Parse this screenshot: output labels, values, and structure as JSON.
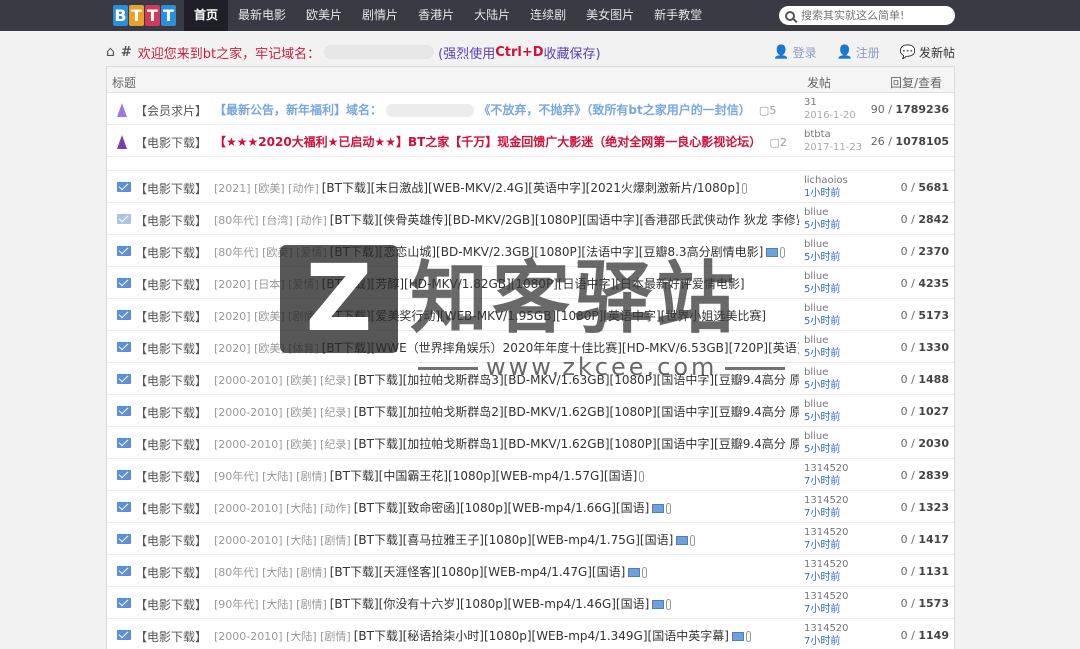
{
  "logo": [
    "B",
    "T",
    "T",
    "T"
  ],
  "nav": [
    "首页",
    "最新电影",
    "欧美片",
    "剧情片",
    "香港片",
    "大陆片",
    "连续剧",
    "美女图片",
    "新手教堂"
  ],
  "search": {
    "placeholder": "搜索其实就这么简单!"
  },
  "welcome": {
    "part1": "欢迎您来到bt之家，牢记域名：",
    "part2": "(强烈使用",
    "ctrl": "Ctrl+D",
    "part3": "收藏保存)"
  },
  "user_links": {
    "login": "登录",
    "register": "注册",
    "post": "发新帖"
  },
  "table_header": {
    "title": "标题",
    "author": "发帖",
    "replies": "回复/查看"
  },
  "pinned": [
    {
      "cat": "【会员求片】",
      "t1": "【最新公告，新年福利】域名：",
      "t2": "《不放弃，不抛弃》（致所有bt之家用户的一封信）",
      "count": "5",
      "author": "31",
      "time": "2016-1-20",
      "replies": "90",
      "views": "1789236"
    },
    {
      "cat": "【电影下载】",
      "t1": "【★★★2020大福利★已启动★★】BT之家【千万】现金回馈广大影迷（绝对全网第一良心影视论坛）",
      "count": "2",
      "author": "btbta",
      "time": "2017-11-23",
      "replies": "26",
      "views": "1078105"
    }
  ],
  "rows": [
    {
      "cat": "【电影下载】",
      "tags": "[2021] [欧美] [动作]",
      "title": "[BT下载][末日激战][WEB-MKV/2.4G][英语中字][2021火爆刺激新片/1080p]",
      "author": "lichaoios",
      "time": "1小时前",
      "replies": "0",
      "views": "5681"
    },
    {
      "cat": "【电影下载】",
      "tags": "[80年代] [台湾] [动作]",
      "title": "[BT下载][侠骨英雄传][BD-MKV/2GB][1080P][国语中字][香港邵氏武侠动作 狄龙 李修贤",
      "author": "bliue",
      "time": "5小时前",
      "replies": "0",
      "views": "2842"
    },
    {
      "cat": "【电影下载】",
      "tags": "[80年代] [欧美] [爱情]",
      "title": "[BT下载][恋恋山城][BD-MKV/2.3GB][1080P][法语中字][豆瓣8.3高分剧情电影]",
      "author": "bliue",
      "time": "5小时前",
      "replies": "0",
      "views": "2370"
    },
    {
      "cat": "【电影下载】",
      "tags": "[2020] [日本] [爱情]",
      "title": "[BT下载][芳醇][HD-MKV/1.82GB][1080P][日语中字][日本最新好评爱情电影]",
      "author": "bliue",
      "time": "5小时前",
      "replies": "0",
      "views": "4235"
    },
    {
      "cat": "【电影下载】",
      "tags": "[2020] [欧美] [剧情]",
      "title": "[BT下载][爱美奖行动][WEB-MKV/1.95GB][1080P][英语中字][世界小姐选美比赛]",
      "author": "bliue",
      "time": "5小时前",
      "replies": "0",
      "views": "5173"
    },
    {
      "cat": "【电影下载】",
      "tags": "[2020] [欧美] [体育]",
      "title": "[BT下载][WWE（世界摔角娱乐）2020年年度十佳比赛][HD-MKV/6.53GB][720P][英语]",
      "author": "bliue",
      "time": "5小时前",
      "replies": "0",
      "views": "1330"
    },
    {
      "cat": "【电影下载】",
      "tags": "[2000-2010] [欧美] [纪录]",
      "title": "[BT下载][加拉帕戈斯群岛3][BD-MKV/1.63GB][1080P][国语中字][豆瓣9.4高分 原生",
      "author": "bliue",
      "time": "5小时前",
      "replies": "0",
      "views": "1488"
    },
    {
      "cat": "【电影下载】",
      "tags": "[2000-2010] [欧美] [纪录]",
      "title": "[BT下载][加拉帕戈斯群岛2][BD-MKV/1.62GB][1080P][国语中字][豆瓣9.4高分 原生",
      "author": "bliue",
      "time": "5小时前",
      "replies": "0",
      "views": "1027"
    },
    {
      "cat": "【电影下载】",
      "tags": "[2000-2010] [欧美] [纪录]",
      "title": "[BT下载][加拉帕戈斯群岛1][BD-MKV/1.62GB][1080P][国语中字][豆瓣9.4高分 原生",
      "author": "bliue",
      "time": "5小时前",
      "replies": "0",
      "views": "2030"
    },
    {
      "cat": "【电影下载】",
      "tags": "[90年代] [大陆] [剧情]",
      "title": "[BT下载][中国霸王花][1080p][WEB-mp4/1.57G][国语]",
      "author": "1314520",
      "time": "7小时前",
      "replies": "0",
      "views": "2839"
    },
    {
      "cat": "【电影下载】",
      "tags": "[2000-2010] [大陆] [动作]",
      "title": "[BT下载][致命密函][1080p][WEB-mp4/1.66G][国语]",
      "author": "1314520",
      "time": "7小时前",
      "replies": "0",
      "views": "1323"
    },
    {
      "cat": "【电影下载】",
      "tags": "[2000-2010] [大陆] [剧情]",
      "title": "[BT下载][喜马拉雅王子][1080p][WEB-mp4/1.75G][国语]",
      "author": "1314520",
      "time": "7小时前",
      "replies": "0",
      "views": "1417"
    },
    {
      "cat": "【电影下载】",
      "tags": "[80年代] [大陆] [剧情]",
      "title": "[BT下载][天涯怪客][1080p][WEB-mp4/1.47G][国语]",
      "author": "1314520",
      "time": "7小时前",
      "replies": "0",
      "views": "1131"
    },
    {
      "cat": "【电影下载】",
      "tags": "[90年代] [大陆] [剧情]",
      "title": "[BT下载][你没有十六岁][1080p][WEB-mp4/1.46G][国语]",
      "author": "1314520",
      "time": "7小时前",
      "replies": "0",
      "views": "1573"
    },
    {
      "cat": "【电影下载】",
      "tags": "[2000-2010] [大陆] [剧情]",
      "title": "[BT下载][秘语拾柒小时][1080p][WEB-mp4/1.349G][国语中英字幕]",
      "author": "1314520",
      "time": "7小时前",
      "replies": "0",
      "views": "1149"
    }
  ],
  "watermark": {
    "mark": "Z",
    "cn": "知客驿站",
    "url": "www.zkcee.com"
  }
}
